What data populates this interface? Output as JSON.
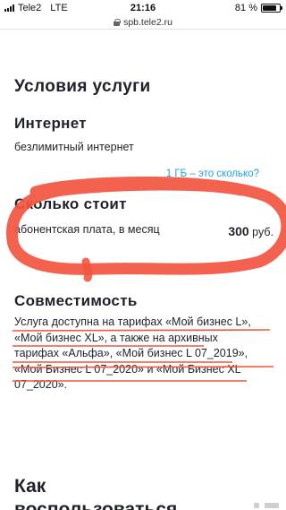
{
  "status_bar": {
    "carrier": "Tele2",
    "network": "LTE",
    "time": "21:16",
    "battery_text": "81 %",
    "battery_level": 0.81
  },
  "url_bar": {
    "url": "spb.tele2.ru"
  },
  "page": {
    "title": "Условия услуги",
    "internet": {
      "heading": "Интернет",
      "value": "безлимитный интернет",
      "link": "1 ГБ – это сколько?"
    },
    "price": {
      "heading": "Сколько стоит",
      "label": "абонентская плата, в месяц",
      "amount": "300",
      "currency": "руб."
    },
    "compat": {
      "heading": "Совместимость",
      "line1": "Услуга доступна на тарифах «Мой бизнес L»,",
      "line2": "«Мой бизнес XL», а также на архивных",
      "line3": "тарифах «Альфа», «Мой бизнес L 07_2019»,",
      "line4": "«Мой Бизнес L 07_2020» и «Мой Бизнес XL",
      "line5": "07_2020»."
    },
    "howto": {
      "line1": "Как",
      "line2": "воспользоваться"
    }
  },
  "colors": {
    "text": "#1f2229",
    "link": "#1fa0e6",
    "annotation": "#f2553f"
  }
}
